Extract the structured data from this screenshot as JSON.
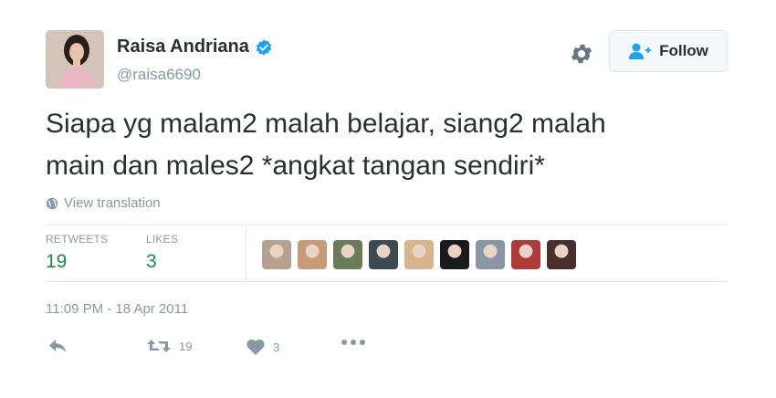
{
  "user": {
    "name": "Raisa Andriana",
    "handle": "@raisa6690"
  },
  "follow_button": {
    "label": "Follow"
  },
  "tweet": {
    "text_line1": "Siapa yg malam2 malah belajar, siang2 malah",
    "text_line2": "main dan males2 *angkat tangan sendiri*",
    "translate_label": "View translation",
    "timestamp": "11:09 PM - 18 Apr 2011"
  },
  "stats": {
    "retweets_label": "RETWEETS",
    "retweets_value": "19",
    "likes_label": "LIKES",
    "likes_value": "3"
  },
  "actions": {
    "retweet_count": "19",
    "like_count": "3"
  },
  "likers": [
    {
      "icon": "liker-avatar",
      "color": "#b8a090"
    },
    {
      "icon": "liker-avatar",
      "color": "#c79a7a"
    },
    {
      "icon": "liker-avatar",
      "color": "#6b7a58"
    },
    {
      "icon": "liker-avatar",
      "color": "#3d4a52"
    },
    {
      "icon": "liker-avatar",
      "color": "#d8b48a"
    },
    {
      "icon": "liker-avatar",
      "color": "#1a1a1a"
    },
    {
      "icon": "liker-avatar",
      "color": "#8a95a5"
    },
    {
      "icon": "liker-avatar",
      "color": "#b03a3a"
    },
    {
      "icon": "liker-avatar",
      "color": "#4a2f2f"
    }
  ],
  "colors": {
    "verified_blue": "#1da1f2",
    "stat_green": "#1b8a47",
    "muted": "#8899a6",
    "follow_icon_blue": "#1da1f2"
  }
}
